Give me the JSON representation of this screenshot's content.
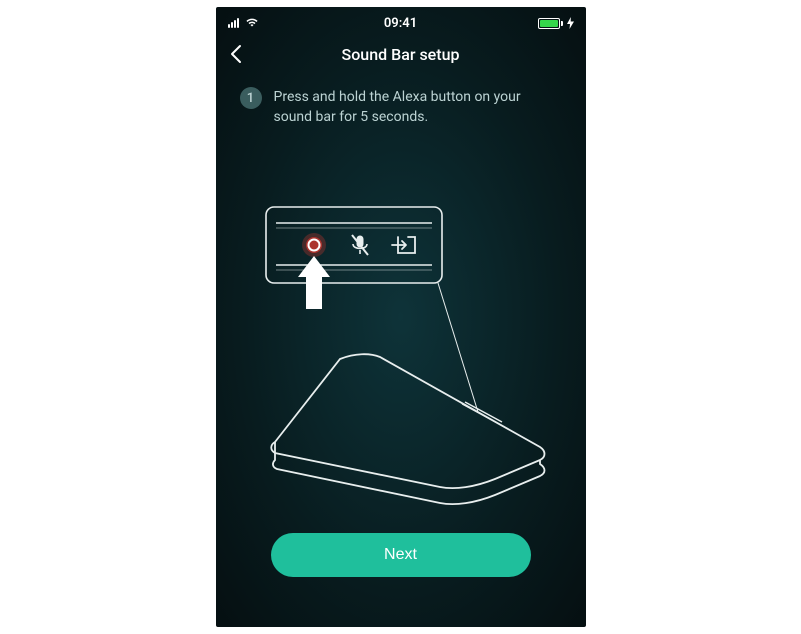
{
  "status_bar": {
    "time": "09:41"
  },
  "header": {
    "title": "Sound Bar setup"
  },
  "step": {
    "number": "1",
    "text": "Press and hold the Alexa button on your sound bar for 5 seconds."
  },
  "footer": {
    "next_label": "Next"
  }
}
